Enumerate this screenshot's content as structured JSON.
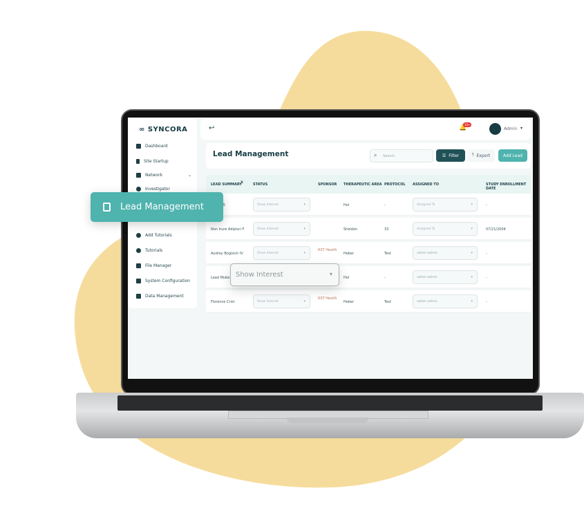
{
  "colors": {
    "blob": "#f6dc9c",
    "accent": "#4fb3ae",
    "dark_teal": "#1f5157",
    "header_bg": "#e8f5f3",
    "badge": "#e53935"
  },
  "brand": "SYNCORA",
  "sidebar": {
    "items": [
      {
        "label": "Dashboard",
        "icon": "grid-icon"
      },
      {
        "label": "Site Startup",
        "icon": "phone-icon"
      },
      {
        "label": "Network",
        "icon": "id-card-icon",
        "has_submenu": true
      },
      {
        "label": "Investigator",
        "icon": "person-icon"
      },
      {
        "label": "Add Tutorials",
        "icon": "play-icon"
      },
      {
        "label": "Tutorials",
        "icon": "play-icon"
      },
      {
        "label": "File Manager",
        "icon": "folder-icon"
      },
      {
        "label": "System Configuration",
        "icon": "gear-icon"
      },
      {
        "label": "Data Management",
        "icon": "database-icon"
      }
    ]
  },
  "topbar": {
    "notification_badge": "10+",
    "user": "Admin"
  },
  "page": {
    "title": "Lead Management",
    "search_placeholder": "Search",
    "filter": "Filter",
    "export": "Export",
    "add": "Add Lead"
  },
  "table": {
    "columns": [
      "LEAD SUMMARY",
      "STATUS",
      "SPONSOR",
      "THERAPEUTIC AREA",
      "PROTOCOL",
      "ASSIGNED TO",
      "STUDY ENROLLMENT DATE"
    ],
    "rows": [
      {
        "lead": "Test 115",
        "status": "Show Interest",
        "sponsor": "",
        "area": "Hol",
        "protocol": "-",
        "assigned": "Assigned To",
        "date": "-"
      },
      {
        "lead": "Non Irure Adipisci F",
        "status": "Show Interest",
        "sponsor": "",
        "area": "Sheldon",
        "protocol": "33",
        "assigned": "Assigned To",
        "date": "07/21/2004"
      },
      {
        "lead": "Audrey Bogisich IV",
        "status": "Show Interest",
        "sponsor": "RST Health",
        "area": "Heber",
        "protocol": "Test",
        "assigned": "admin admin",
        "date": "-"
      },
      {
        "lead": "Lead Mube",
        "status": "",
        "sponsor": "",
        "area": "Hol",
        "protocol": "-",
        "assigned": "admin admin",
        "date": "-"
      },
      {
        "lead": "Florence Crist",
        "status": "Show Interest",
        "sponsor": "RST Health",
        "area": "Heber",
        "protocol": "Test",
        "assigned": "admin admin",
        "date": "-"
      }
    ]
  },
  "callouts": {
    "menu_item": "Lead Management",
    "dropdown": "Show Interest"
  }
}
